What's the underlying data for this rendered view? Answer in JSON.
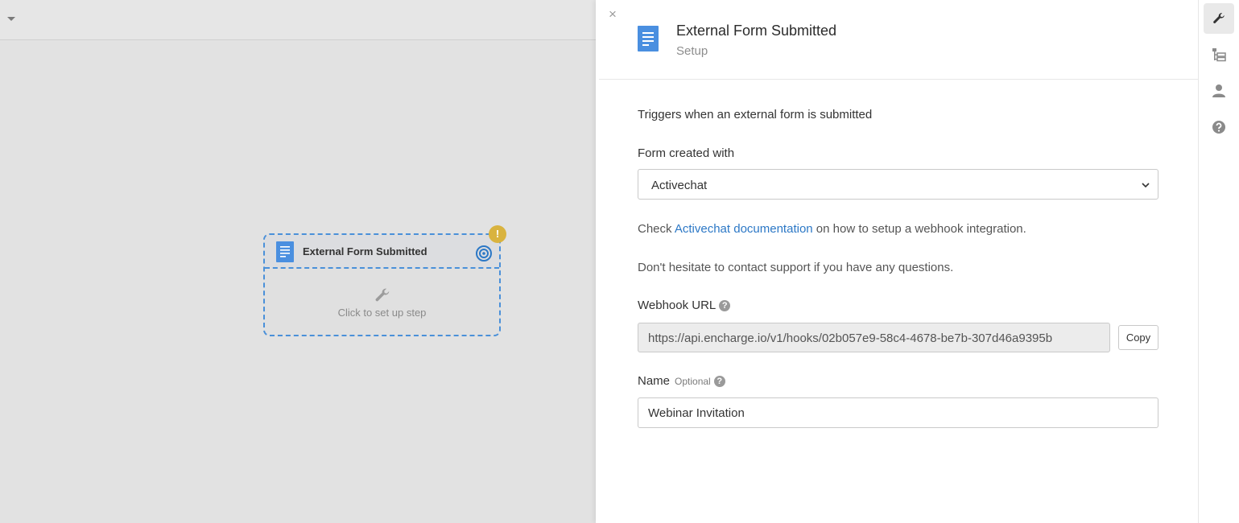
{
  "canvas": {
    "step": {
      "title": "External Form Submitted",
      "warning_badge": "!",
      "setup_label": "Click to set up step",
      "icons": [
        "document-icon",
        "target-icon",
        "wrench-icon",
        "warning-icon"
      ]
    }
  },
  "panel": {
    "close_label": "×",
    "title": "External Form Submitted",
    "subtitle": "Setup",
    "trigger_description": "Triggers when an external form is submitted",
    "form_field": {
      "label": "Form created with",
      "selected": "Activechat"
    },
    "documentation": {
      "prefix": "Check ",
      "link": "Activechat documentation",
      "suffix": " on how to setup a webhook integration."
    },
    "support_text": "Don't hesitate to contact support if you have any questions.",
    "webhook": {
      "label": "Webhook URL",
      "help": "?",
      "value": "https://api.encharge.io/v1/hooks/02b057e9-58c4-4678-be7b-307d46a9395b",
      "copy_label": "Copy"
    },
    "name_field": {
      "label": "Name",
      "optional_label": "Optional",
      "help": "?",
      "value": "Webinar Invitation"
    }
  },
  "rail": {
    "items": [
      "wrench-icon",
      "tree-icon",
      "user-icon",
      "help-icon"
    ]
  },
  "colors": {
    "accent": "#2c78c6",
    "dashed_border": "#4a90d9",
    "warning": "#d9b33f",
    "doc_icon": "#4a8fe0"
  }
}
